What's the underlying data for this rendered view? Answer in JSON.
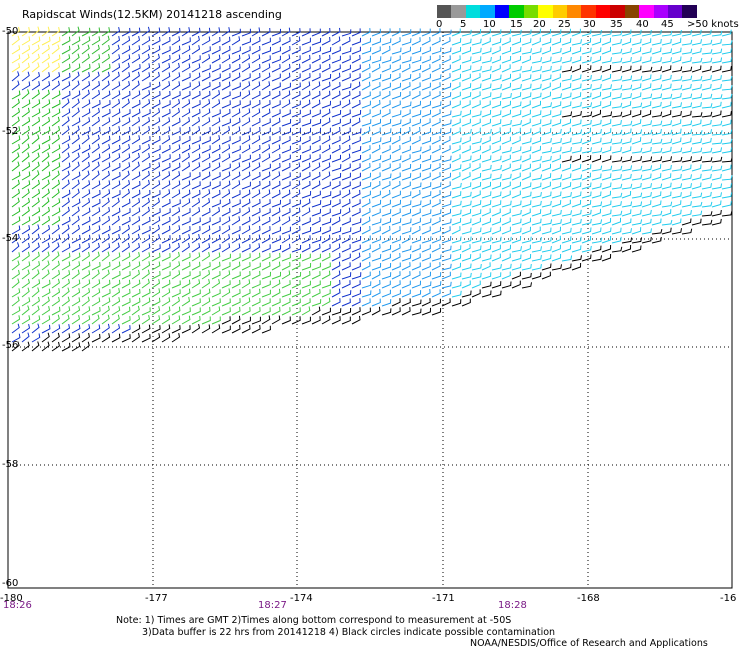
{
  "title": "Rapidscat Winds(12.5KM) 20141218 ascending",
  "speed_scale": {
    "labels": [
      "0",
      "5",
      "10",
      "15",
      "20",
      "25",
      "30",
      "35",
      "40",
      "45",
      ">50 knots"
    ],
    "colors": [
      "#555555",
      "#999999",
      "#00dddd",
      "#00aaff",
      "#0000ff",
      "#00cc00",
      "#77dd00",
      "#ffff00",
      "#ffcc00",
      "#ff8800",
      "#ff3300",
      "#ff0000",
      "#cc0000",
      "#884400",
      "#ff00ff",
      "#aa00ff",
      "#6600cc",
      "#220055"
    ]
  },
  "map": {
    "lat_labels": [
      "-50",
      "-52",
      "-54",
      "-56",
      "-58",
      "-60"
    ],
    "lon_labels": [
      "-180",
      "-177",
      "-174",
      "-171",
      "-168",
      "-16"
    ],
    "time_labels": [
      "18:26",
      "18:27",
      "18:28"
    ],
    "lon_range": [
      -180,
      -165
    ],
    "lat_range": [
      -50,
      -60
    ]
  },
  "notes": {
    "line1": "Note: 1) Times are GMT 2)Times along bottom correspond to measurement at -50S",
    "line2": "3)Data buffer is 22 hrs from 20141218 4) Black circles indicate possible contamination",
    "agency": "NOAA/NESDIS/Office of Research and Applications"
  }
}
